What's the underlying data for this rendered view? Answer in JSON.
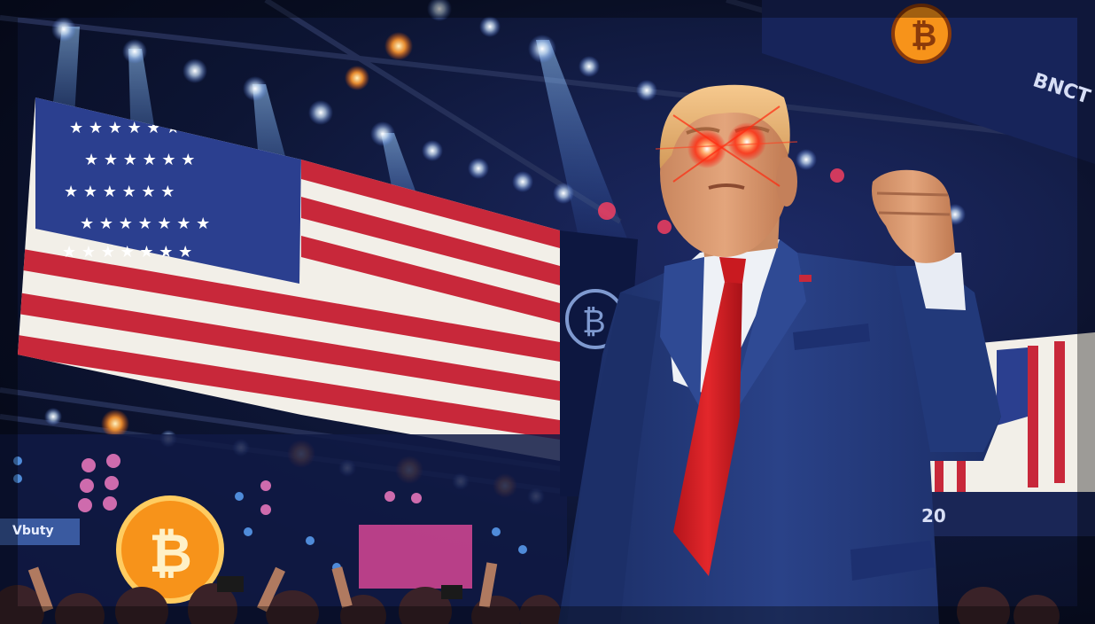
{
  "scene": {
    "description_label": "",
    "colors": {
      "background_navy": "#0d1534",
      "flag_red": "#c8283a",
      "flag_white": "#f2efe8",
      "flag_blue": "#2b3f8f",
      "suit_navy": "#243a78",
      "tie_red": "#d81e24",
      "laser_eye_red": "#ff2a10",
      "bitcoin_orange": "#f7931a",
      "stage_light": "#eaf4ff"
    },
    "icons": [
      "bitcoin-logo-icon",
      "us-flag-icon",
      "laser-eye-icon"
    ]
  },
  "signage": {
    "top_right": "BNCT",
    "bottom_right_left": "20",
    "bottom_left": "Vbuty"
  }
}
